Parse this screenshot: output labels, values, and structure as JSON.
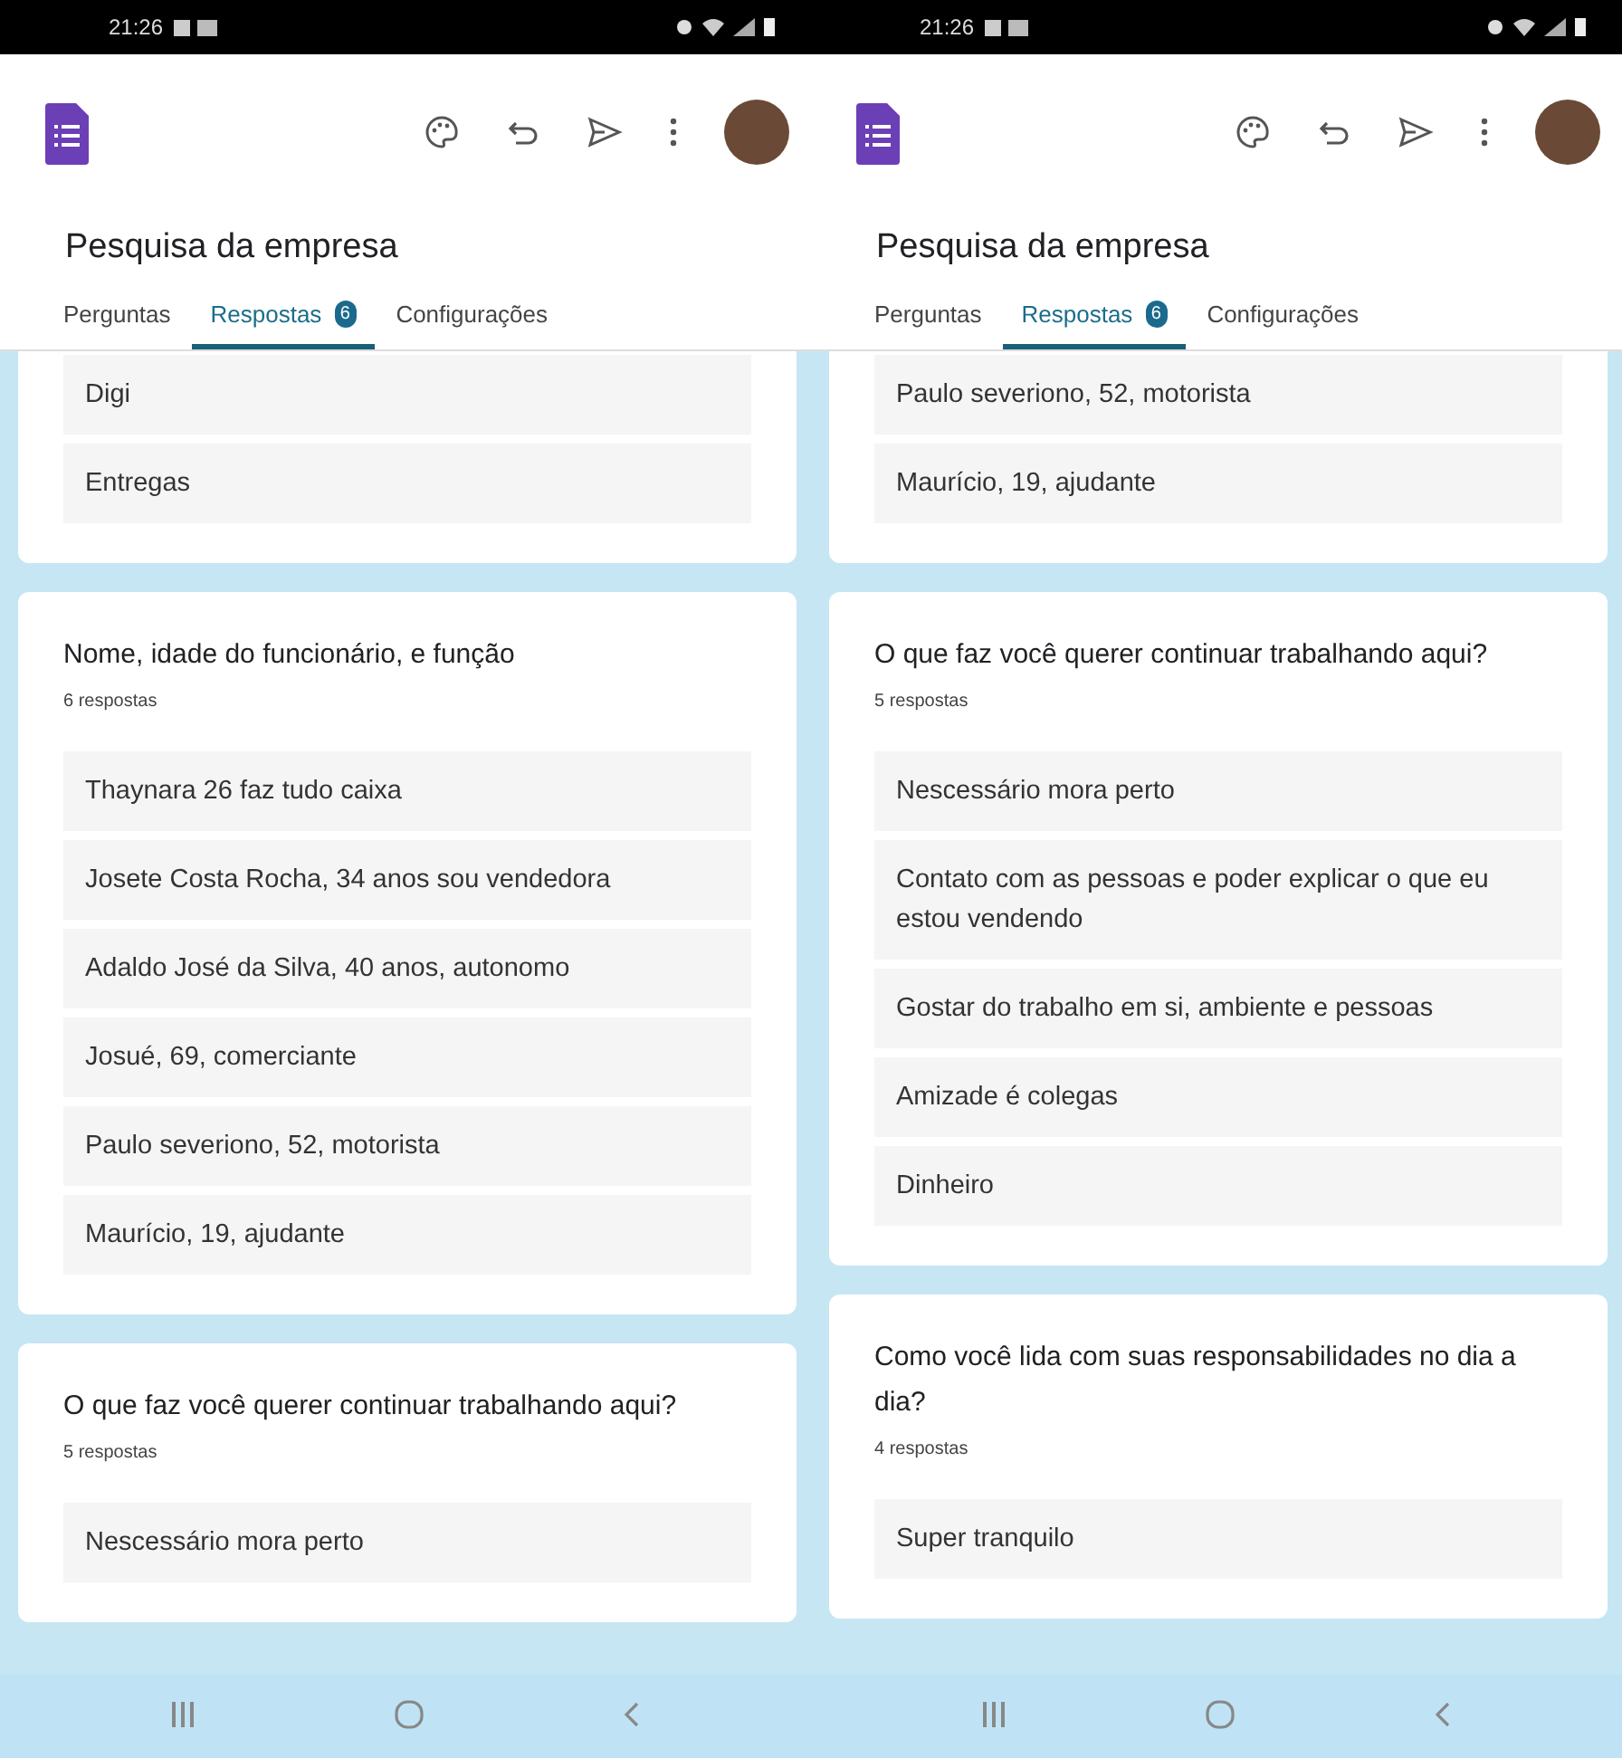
{
  "phones": [
    {
      "status_bar": {
        "time": "21:26"
      },
      "form_title": "Pesquisa da empresa",
      "tabs": [
        {
          "label": "Perguntas",
          "selected": false
        },
        {
          "label": "Respostas",
          "badge": "6",
          "selected": true
        },
        {
          "label": "Configurações",
          "selected": false
        }
      ],
      "cards": [
        {
          "answers": [
            "Digi",
            "Entregas"
          ]
        },
        {
          "question": "Nome, idade do funcionário,  e função",
          "count": "6 respostas",
          "answers": [
            "Thaynara 26 faz tudo caixa",
            "Josete Costa Rocha, 34 anos sou vendedora",
            "Adaldo José da Silva, 40 anos, autonomo",
            "Josué, 69, comerciante",
            "Paulo severiono, 52, motorista",
            "Maurício, 19, ajudante"
          ]
        },
        {
          "question": "O que faz você querer continuar trabalhando aqui?",
          "count": "5 respostas",
          "answers": [
            "Nescessário mora perto"
          ]
        }
      ]
    },
    {
      "status_bar": {
        "time": "21:26"
      },
      "form_title": "Pesquisa da empresa",
      "tabs": [
        {
          "label": "Perguntas",
          "selected": false
        },
        {
          "label": "Respostas",
          "badge": "6",
          "selected": true
        },
        {
          "label": "Configurações",
          "selected": false
        }
      ],
      "cards": [
        {
          "answers": [
            "Paulo severiono, 52, motorista",
            "Maurício, 19, ajudante"
          ]
        },
        {
          "question": "O que faz você querer continuar trabalhando aqui?",
          "count": "5 respostas",
          "answers": [
            "Nescessário mora perto",
            "Contato com as pessoas e poder explicar o que eu estou vendendo",
            "Gostar do trabalho em si, ambiente e pessoas",
            "Amizade é colegas",
            "Dinheiro"
          ]
        },
        {
          "question": "Como você lida com suas responsabilidades no dia a dia?",
          "count": "4 respostas",
          "answers": [
            "Super tranquilo"
          ]
        }
      ]
    }
  ]
}
